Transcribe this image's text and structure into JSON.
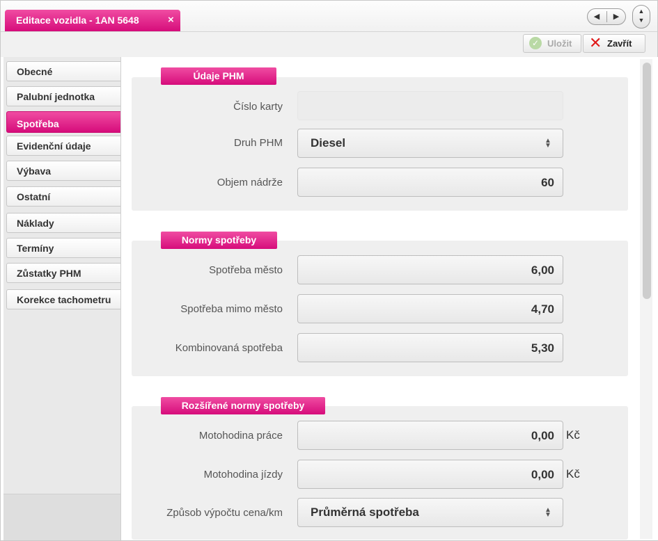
{
  "tab": {
    "title": "Editace vozidla - 1AN 5648",
    "close": "×"
  },
  "toolbar": {
    "save_label": "Uložit",
    "close_label": "Zavřít"
  },
  "sidebar": {
    "items": [
      {
        "label": "Obecné"
      },
      {
        "label": "Palubní jednotka"
      },
      {
        "label": "Spotřeba"
      },
      {
        "label": "Evidenční údaje"
      },
      {
        "label": "Výbava"
      },
      {
        "label": "Ostatní"
      },
      {
        "label": "Náklady"
      },
      {
        "label": "Termíny"
      },
      {
        "label": "Zůstatky PHM"
      },
      {
        "label": "Korekce tachometru"
      }
    ],
    "active": "Spotřeba"
  },
  "sections": {
    "phm": {
      "title": "Údaje PHM",
      "card_label": "Číslo karty",
      "card_value": "",
      "fuel_label": "Druh PHM",
      "fuel_value": "Diesel",
      "tank_label": "Objem nádrže",
      "tank_value": "60"
    },
    "norms": {
      "title": "Normy spotřeby",
      "city_label": "Spotřeba město",
      "city_value": "6,00",
      "outside_label": "Spotřeba mimo město",
      "outside_value": "4,70",
      "combined_label": "Kombinovaná spotřeba",
      "combined_value": "5,30"
    },
    "extended": {
      "title": "Rozšířené normy spotřeby",
      "work_label": "Motohodina práce",
      "work_value": "0,00",
      "work_unit": "Kč",
      "drive_label": "Motohodina jízdy",
      "drive_value": "0,00",
      "drive_unit": "Kč",
      "method_label": "Způsob výpočtu cena/km",
      "method_value": "Průměrná spotřeba"
    }
  },
  "colors": {
    "accent": "#d60c7b",
    "accent_light": "#f04ca2"
  },
  "icons": {
    "save": "check-circle-icon",
    "close": "red-x-icon"
  }
}
